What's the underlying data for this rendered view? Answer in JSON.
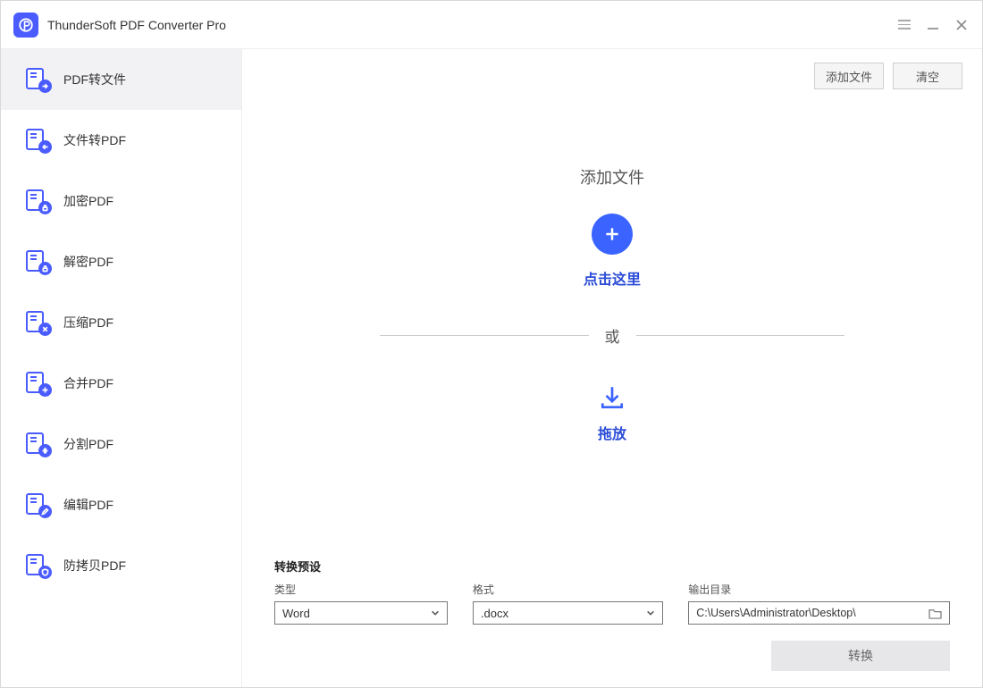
{
  "app": {
    "title": "ThunderSoft PDF Converter Pro"
  },
  "sidebar": {
    "items": [
      {
        "label": "PDF转文件",
        "badge": "arrow-right"
      },
      {
        "label": "文件转PDF",
        "badge": "arrow-left"
      },
      {
        "label": "加密PDF",
        "badge": "lock"
      },
      {
        "label": "解密PDF",
        "badge": "unlock"
      },
      {
        "label": "压缩PDF",
        "badge": "compress"
      },
      {
        "label": "合并PDF",
        "badge": "plus"
      },
      {
        "label": "分割PDF",
        "badge": "split"
      },
      {
        "label": "编辑PDF",
        "badge": "edit"
      },
      {
        "label": "防拷贝PDF",
        "badge": "shield"
      }
    ]
  },
  "toolbar": {
    "add_label": "添加文件",
    "clear_label": "清空"
  },
  "drop": {
    "title": "添加文件",
    "click_here": "点击这里",
    "or": "或",
    "drag": "拖放"
  },
  "presets": {
    "title": "转换预设",
    "type_label": "类型",
    "type_value": "Word",
    "format_label": "格式",
    "format_value": ".docx",
    "output_label": "输出目录",
    "output_value": "C:\\Users\\Administrator\\Desktop\\",
    "convert_label": "转换"
  }
}
